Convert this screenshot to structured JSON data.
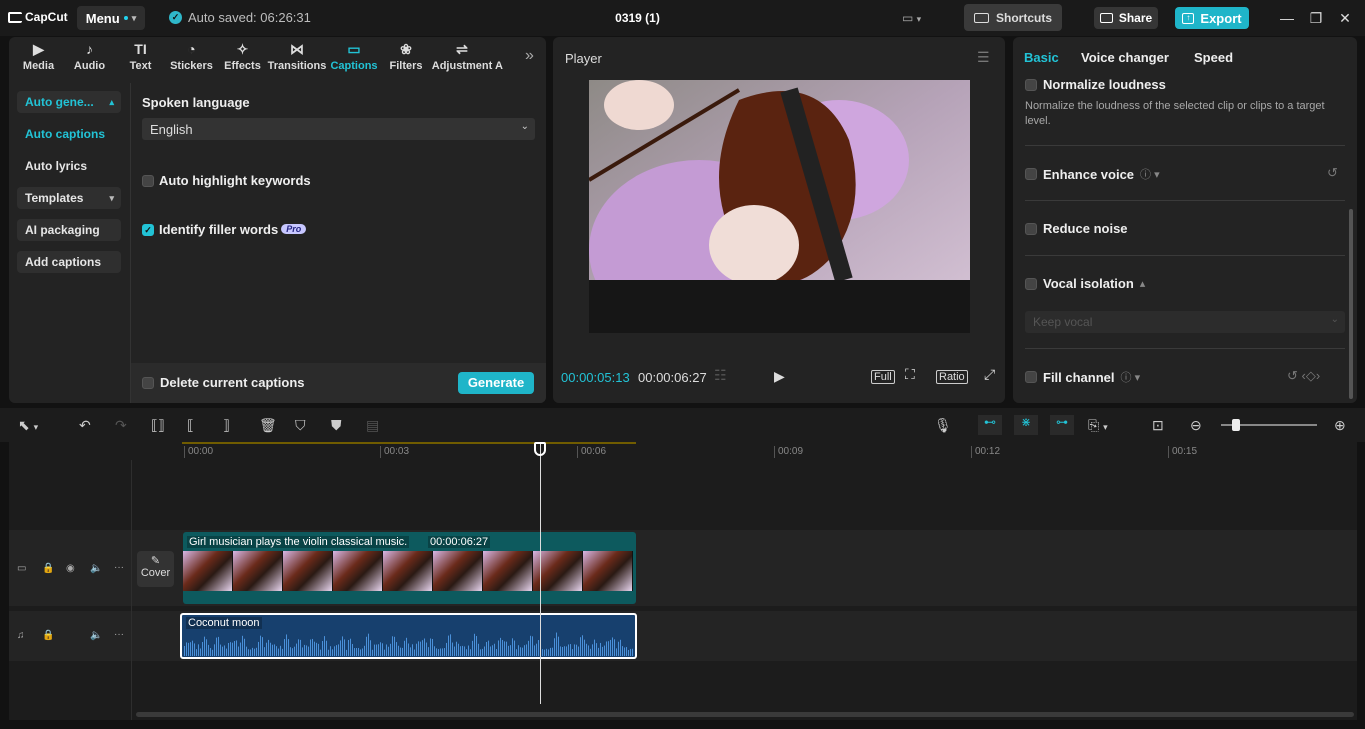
{
  "titlebar": {
    "logo": "CapCut",
    "menu": "Menu",
    "autosaved": "Auto saved: 06:26:31",
    "project_title": "0319 (1)",
    "shortcuts": "Shortcuts",
    "share": "Share",
    "export": "Export"
  },
  "toolbar": {
    "items": [
      {
        "label": "Media",
        "icon": "▶"
      },
      {
        "label": "Audio",
        "icon": "♪"
      },
      {
        "label": "Text",
        "icon": "TI"
      },
      {
        "label": "Stickers",
        "icon": "◔"
      },
      {
        "label": "Effects",
        "icon": "✧"
      },
      {
        "label": "Transitions",
        "icon": "⋈"
      },
      {
        "label": "Captions",
        "icon": "▭"
      },
      {
        "label": "Filters",
        "icon": "❀"
      },
      {
        "label": "Adjustment",
        "icon": "⇌"
      },
      {
        "label": "A",
        "icon": ""
      }
    ]
  },
  "sidebar": {
    "items": [
      "Auto gene...",
      "Auto captions",
      "Auto lyrics",
      "Templates",
      "AI packaging",
      "Add captions"
    ]
  },
  "captions": {
    "spoken_language_label": "Spoken language",
    "language_value": "English",
    "auto_highlight": "Auto highlight keywords",
    "identify_filler": "Identify filler words",
    "pro_badge": "Pro",
    "delete_current": "Delete current captions",
    "generate": "Generate"
  },
  "player": {
    "title": "Player",
    "current_time": "00:00:05:13",
    "total_time": "00:00:06:27",
    "full": "Full",
    "ratio": "Ratio"
  },
  "right_panel": {
    "tabs": [
      "Basic",
      "Voice changer",
      "Speed"
    ],
    "normalize_loudness": "Normalize loudness",
    "normalize_desc": "Normalize the loudness of the selected clip or clips to a target level.",
    "enhance_voice": "Enhance voice",
    "reduce_noise": "Reduce noise",
    "vocal_isolation": "Vocal isolation",
    "keep_vocal": "Keep vocal",
    "fill_channel": "Fill channel"
  },
  "timeline": {
    "ruler": [
      "00:00",
      "00:03",
      "00:06",
      "00:09",
      "00:12",
      "00:15"
    ],
    "cover": "Cover",
    "video_clip_title": "Girl musician plays the violin classical music.",
    "video_clip_duration": "00:00:06:27",
    "audio_clip_title": "Coconut moon"
  },
  "colors": {
    "accent": "#22c3d6",
    "export_bg": "#1fb5c9",
    "video_clip": "#0d5a5e",
    "audio_clip": "#17406e"
  }
}
